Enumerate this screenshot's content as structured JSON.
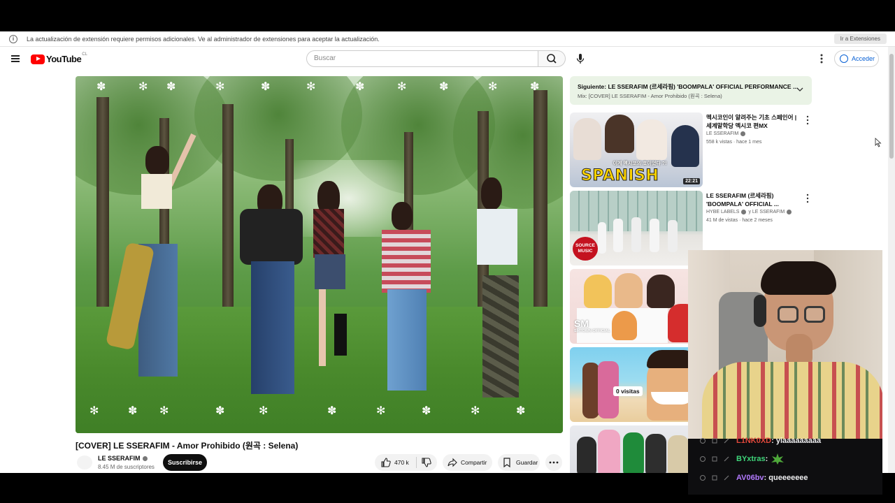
{
  "infobar": {
    "message": "La actualización de extensión requiere permisos adicionales. Ve al administrador de extensiones para aceptar la actualización.",
    "button": "Ir a Extensiones",
    "icon": "info-icon"
  },
  "header": {
    "logo_text": "YouTube",
    "logo_country": "CL",
    "search_placeholder": "Buscar",
    "signin_label": "Acceder"
  },
  "video": {
    "title": "[COVER] LE SSERAFIM - Amor Prohibido (원곡 : Selena)",
    "channel": "LE SSERAFIM",
    "subscribers": "8.45 M de suscriptores",
    "subscribe_label": "Suscribirse",
    "likes": "470 k",
    "share_label": "Compartir",
    "save_label": "Guardar"
  },
  "up_next": {
    "title": "Siguiente: LE SSERAFIM (르세라핌) 'BOOMPALA' OFFICIAL PERFORMANCE ...",
    "subtitle": "Mix: [COVER] LE SSERAFIM - Amor Prohibido (원곡 : Selena)"
  },
  "recommendations": [
    {
      "title": "멕시코인이 알려주는 기초 스페인어 | 세계말학당 멕시코 편MX",
      "channel": "LE SSERAFIM",
      "meta": "558 k vistas · hace 1 mes",
      "duration": "22:21",
      "thumb_text": "SPANISH",
      "thumb_caption": "이게 멕시코의 호이었다 ?!"
    },
    {
      "title": "LE SSERAFIM (르세라핌) 'BOOMPALA' OFFICIAL ...",
      "channel": "HYBE LABELS",
      "channel_extra": "y LE SSERAFIM",
      "meta": "41 M de vistas · hace 2 meses",
      "thumb_badge_line1": "SOURCE",
      "thumb_badge_line2": "MUSIC"
    },
    {
      "thumb_badge_line1": "SM",
      "thumb_badge_line2": "SMTOWN OFFICIAL"
    },
    {
      "thumb_label": "0 visitas"
    },
    {}
  ],
  "chat": [
    {
      "user": "L1NK0XD",
      "message": "yiaaaaaaaaa",
      "color": "#e0483b"
    },
    {
      "user": "BYxtras",
      "message": "",
      "color": "#3fd67a"
    },
    {
      "user": "AV06bv",
      "message": "queeeeeee",
      "color": "#b37aff"
    }
  ],
  "colors": {
    "youtube_red": "#ff0000",
    "link_blue": "#065fd4",
    "chat_bg": "#0e0e10"
  }
}
